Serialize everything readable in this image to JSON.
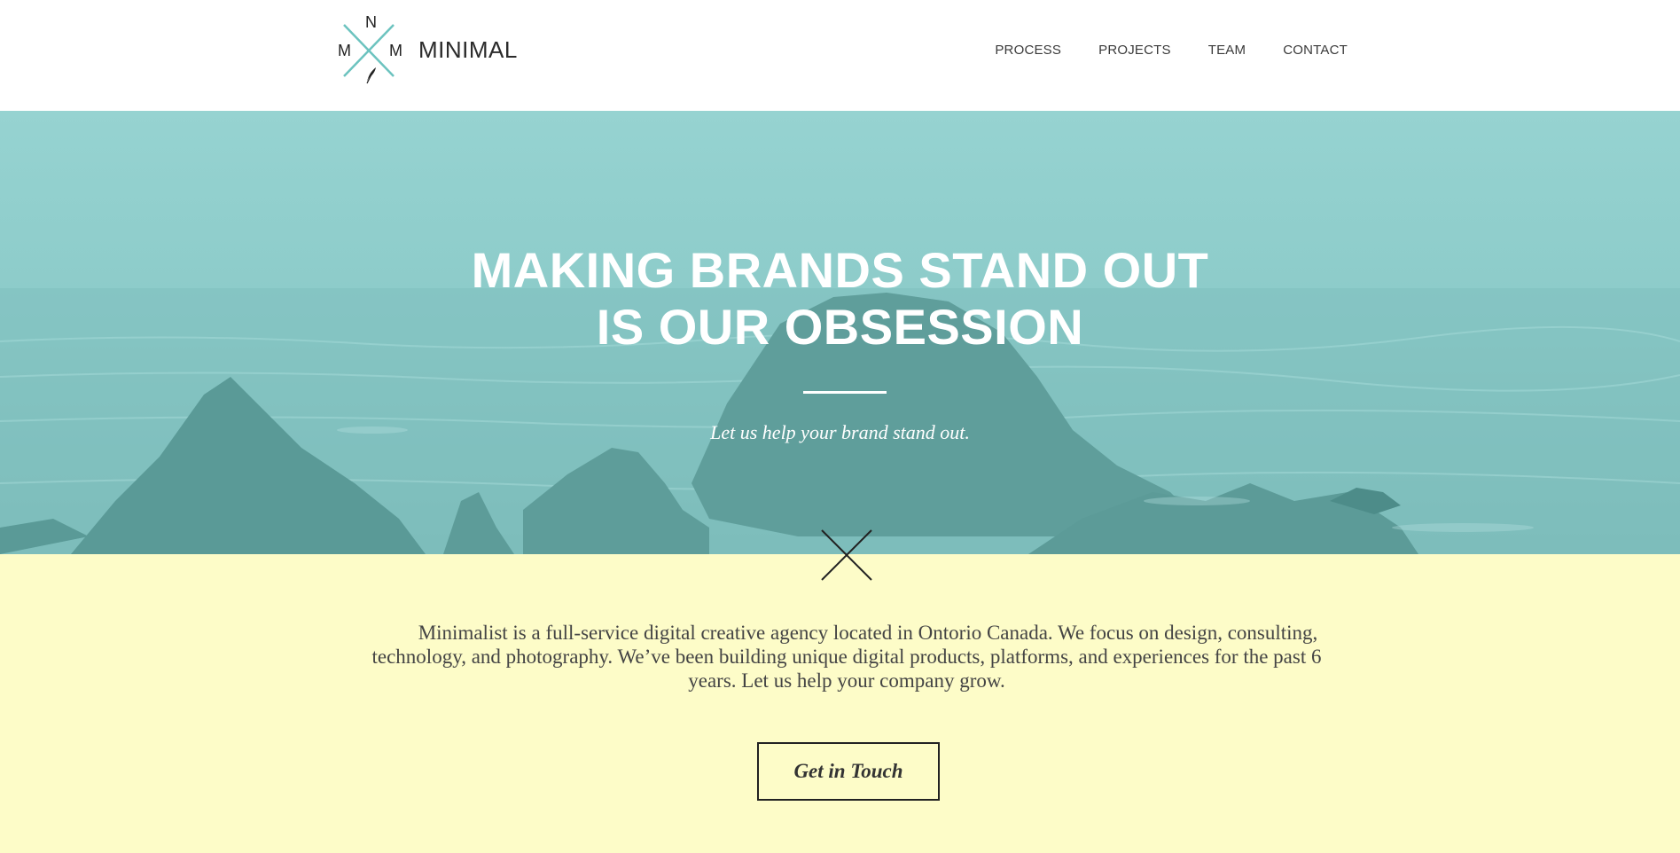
{
  "brand": {
    "name": "MINIMAL",
    "compass": {
      "north": "N",
      "west": "M",
      "east": "M"
    },
    "accent_color": "#6cc3bf"
  },
  "nav": {
    "items": [
      {
        "label": "PROCESS"
      },
      {
        "label": "PROJECTS"
      },
      {
        "label": "TEAM"
      },
      {
        "label": "CONTACT"
      }
    ]
  },
  "hero": {
    "title_line1": "MAKING BRANDS STAND OUT",
    "title_line2": "IS OUR OBSESSION",
    "subtitle": "Let us help your brand stand out.",
    "overlay_color": "#8fcfcd"
  },
  "about": {
    "text": "Minimalist is a full-service digital creative agency located in Ontorio Canada. We focus on design, consulting, technology, and photography. We’ve been building unique digital products, platforms, and experiences for the past 6 years. Let us help your company grow.",
    "cta_label": "Get in Touch",
    "background_color": "#fdfcc8"
  },
  "icons": {
    "logo": "compass-x-icon",
    "feather": "feather-icon",
    "divider": "x-divider-icon"
  }
}
